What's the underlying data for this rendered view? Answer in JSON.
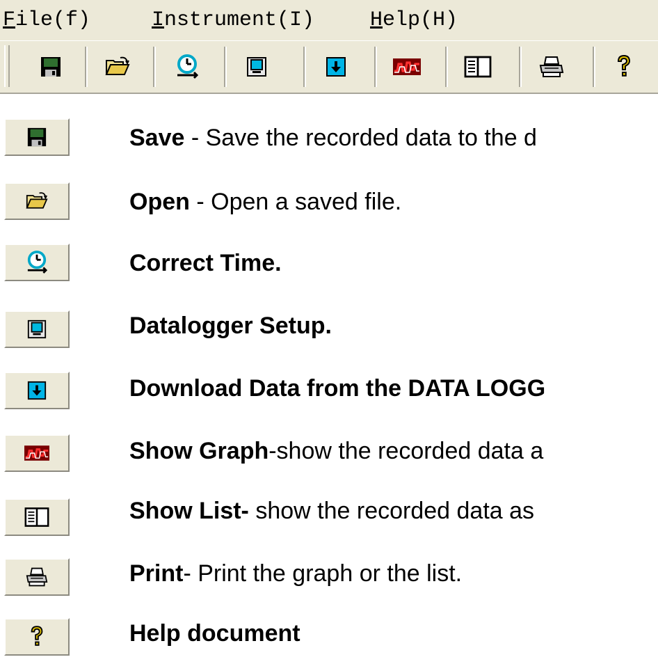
{
  "menubar": {
    "file": {
      "mnemonic": "F",
      "rest": "ile(f)"
    },
    "instrument": {
      "mnemonic": "I",
      "rest": "nstrument(I)"
    },
    "help": {
      "mnemonic": "H",
      "rest": "elp(H)"
    }
  },
  "toolbar": {
    "buttons": [
      {
        "icon": "save-icon"
      },
      {
        "icon": "open-folder-icon"
      },
      {
        "icon": "correct-time-icon"
      },
      {
        "icon": "datalogger-setup-icon"
      },
      {
        "icon": "download-icon"
      },
      {
        "icon": "graph-icon"
      },
      {
        "icon": "list-icon"
      },
      {
        "icon": "print-icon"
      },
      {
        "icon": "help-icon"
      }
    ]
  },
  "legend": [
    {
      "icon": "save-icon",
      "title": "Save",
      "text": " - Save the recorded data to the d"
    },
    {
      "icon": "open-folder-icon",
      "title": "Open",
      "text": " - Open a saved file."
    },
    {
      "icon": "correct-time-icon",
      "title": "Correct Time.",
      "text": ""
    },
    {
      "icon": "datalogger-setup-icon",
      "title": "Datalogger Setup.",
      "text": ""
    },
    {
      "icon": "download-icon",
      "title": "Download Data from the DATA LOGG",
      "text": ""
    },
    {
      "icon": "graph-icon",
      "title": "Show Graph",
      "text": "-show the recorded data a"
    },
    {
      "icon": "list-icon",
      "title": "Show List-",
      "text": " show the recorded data as"
    },
    {
      "icon": "print-icon",
      "title": "Print",
      "text": "- Print the graph or the list."
    },
    {
      "icon": "help-icon",
      "title": "Help document",
      "text": ""
    }
  ],
  "colors": {
    "chrome": "#ece9d8",
    "save_icon": "#2f6f2f",
    "time_icon": "#00a8c8",
    "download_icon": "#00b4e6",
    "graph_icon_bg": "#7a0000",
    "help_icon": "#e0c000"
  }
}
